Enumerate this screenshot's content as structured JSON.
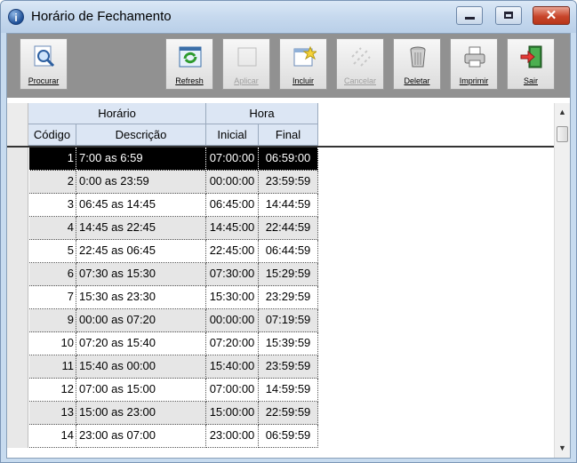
{
  "window": {
    "title": "Horário de Fechamento",
    "controls": {
      "minimize": "minimize",
      "maximize": "maximize",
      "close": "✕"
    }
  },
  "toolbar": {
    "buttons": [
      {
        "label": "Procurar",
        "icon": "search-icon",
        "enabled": true
      },
      {
        "label": "Refresh",
        "icon": "refresh-icon",
        "enabled": true
      },
      {
        "label": "Aplicar",
        "icon": "apply-icon",
        "enabled": false
      },
      {
        "label": "Incluir",
        "icon": "new-record-icon",
        "enabled": true
      },
      {
        "label": "Cancelar",
        "icon": "cancel-icon",
        "enabled": false
      },
      {
        "label": "Deletar",
        "icon": "trash-icon",
        "enabled": true
      },
      {
        "label": "Imprimir",
        "icon": "printer-icon",
        "enabled": true
      },
      {
        "label": "Sair",
        "icon": "exit-door-icon",
        "enabled": true
      }
    ]
  },
  "grid": {
    "group_headers": {
      "horario": "Horário",
      "hora": "Hora"
    },
    "columns": {
      "codigo": "Código",
      "descricao": "Descrição",
      "inicial": "Inicial",
      "final": "Final"
    },
    "rows": [
      {
        "codigo": "1",
        "descricao": "7:00 as 6:59",
        "inicial": "07:00:00",
        "final": "06:59:00"
      },
      {
        "codigo": "2",
        "descricao": "0:00 as 23:59",
        "inicial": "00:00:00",
        "final": "23:59:59"
      },
      {
        "codigo": "3",
        "descricao": "06:45 as 14:45",
        "inicial": "06:45:00",
        "final": "14:44:59"
      },
      {
        "codigo": "4",
        "descricao": "14:45 as 22:45",
        "inicial": "14:45:00",
        "final": "22:44:59"
      },
      {
        "codigo": "5",
        "descricao": "22:45 as 06:45",
        "inicial": "22:45:00",
        "final": "06:44:59"
      },
      {
        "codigo": "6",
        "descricao": "07:30 as 15:30",
        "inicial": "07:30:00",
        "final": "15:29:59"
      },
      {
        "codigo": "7",
        "descricao": "15:30 as 23:30",
        "inicial": "15:30:00",
        "final": "23:29:59"
      },
      {
        "codigo": "9",
        "descricao": "00:00 as 07:20",
        "inicial": "00:00:00",
        "final": "07:19:59"
      },
      {
        "codigo": "10",
        "descricao": "07:20 as 15:40",
        "inicial": "07:20:00",
        "final": "15:39:59"
      },
      {
        "codigo": "11",
        "descricao": "15:40 as 00:00",
        "inicial": "15:40:00",
        "final": "23:59:59"
      },
      {
        "codigo": "12",
        "descricao": "07:00 as 15:00",
        "inicial": "07:00:00",
        "final": "14:59:59"
      },
      {
        "codigo": "13",
        "descricao": "15:00 as 23:00",
        "inicial": "15:00:00",
        "final": "22:59:59"
      },
      {
        "codigo": "14",
        "descricao": "23:00 as 07:00",
        "inicial": "23:00:00",
        "final": "06:59:59"
      }
    ],
    "selected_row": "1"
  },
  "colors": {
    "selection": "#000000",
    "alt_row": "#e6e6e6",
    "header": "#dce6f4",
    "toolbar": "#919191"
  }
}
